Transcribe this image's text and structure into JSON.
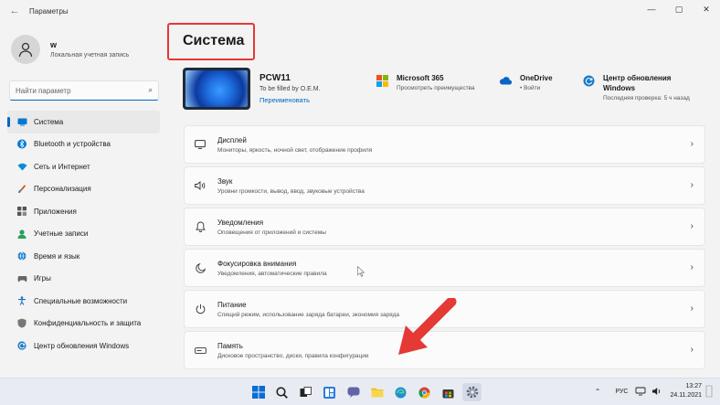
{
  "window": {
    "title": "Параметры",
    "controls": [
      "—",
      "▢",
      "✕"
    ]
  },
  "account": {
    "name": "w",
    "type": "Локальная учетная запись"
  },
  "search": {
    "placeholder": "Найти параметр"
  },
  "sidebar": {
    "items": [
      {
        "label": "Система",
        "icon": "monitor-icon",
        "active": true
      },
      {
        "label": "Bluetooth и устройства",
        "icon": "bluetooth-icon"
      },
      {
        "label": "Сеть и Интернет",
        "icon": "wifi-icon"
      },
      {
        "label": "Персонализация",
        "icon": "brush-icon"
      },
      {
        "label": "Приложения",
        "icon": "apps-icon"
      },
      {
        "label": "Учетные записи",
        "icon": "person-icon"
      },
      {
        "label": "Время и язык",
        "icon": "globe-icon"
      },
      {
        "label": "Игры",
        "icon": "gamepad-icon"
      },
      {
        "label": "Специальные возможности",
        "icon": "accessibility-icon"
      },
      {
        "label": "Конфиденциальность и защита",
        "icon": "shield-icon"
      },
      {
        "label": "Центр обновления Windows",
        "icon": "update-icon"
      }
    ]
  },
  "main": {
    "title": "Система",
    "device": {
      "name": "PCW11",
      "oem": "To be filled by O.E.M.",
      "rename": "Переименовать"
    },
    "info": [
      {
        "title": "Microsoft 365",
        "sub": "Просмотреть преимущества",
        "icon": "microsoft-icon"
      },
      {
        "title": "OneDrive",
        "sub": "• Войти",
        "icon": "cloud-icon"
      },
      {
        "title": "Центр обновления Windows",
        "sub": "Последняя проверка: 5 ч назад",
        "icon": "update-icon"
      }
    ],
    "cards": [
      {
        "title": "Дисплей",
        "sub": "Мониторы, яркость, ночной свет, отображение профиля",
        "icon": "display-icon"
      },
      {
        "title": "Звук",
        "sub": "Уровни громкости, вывод, ввод, звуковые устройства",
        "icon": "speaker-icon"
      },
      {
        "title": "Уведомления",
        "sub": "Оповещения от приложений и системы",
        "icon": "bell-icon"
      },
      {
        "title": "Фокусировка внимания",
        "sub": "Уведомления, автоматические правила",
        "icon": "moon-icon"
      },
      {
        "title": "Питание",
        "sub": "Спящий режим, использование заряда батареи, экономия заряда",
        "icon": "power-icon"
      },
      {
        "title": "Память",
        "sub": "Дисковое пространство, диски, правила конфигурации",
        "icon": "storage-icon"
      }
    ]
  },
  "taskbar": {
    "language": "РУС",
    "time": "13:27",
    "date": "24.11.2021"
  },
  "colors": {
    "accent": "#0067c0",
    "highlight": "#e53935"
  }
}
